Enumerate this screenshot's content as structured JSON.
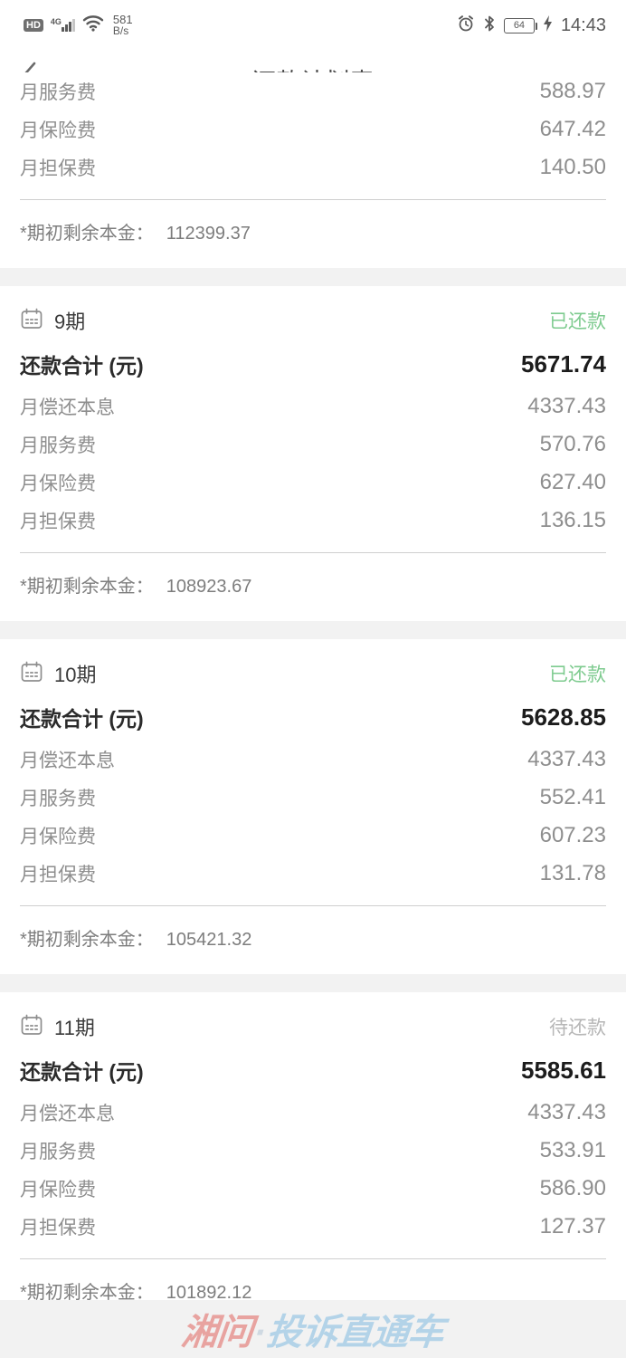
{
  "status_bar": {
    "hd_label": "HD",
    "network_type": "4G",
    "signal_icon": "signal-bars-icon",
    "wifi_icon": "wifi-icon",
    "net_speed_value": "581",
    "net_speed_unit": "B/s",
    "alarm_icon": "alarm-clock-icon",
    "bluetooth_icon": "bluetooth-icon",
    "battery_level": "64",
    "charging_icon": "lightning-bolt-icon",
    "time": "14:43"
  },
  "app_bar": {
    "back_icon": "chevron-left-icon",
    "title": "还款计划表"
  },
  "labels": {
    "principal_interest": "月偿还本息",
    "service_fee": "月服务费",
    "insurance_fee": "月保险费",
    "guarantee_fee": "月担保费",
    "total": "还款合计 (元)",
    "remaining_note": "*期初剩余本金：",
    "calendar_icon": "calendar-icon"
  },
  "status_text": {
    "paid": "已还款",
    "pending": "待还款"
  },
  "colors": {
    "paid": "#7ecb8f",
    "pending": "#b6b6b6",
    "page_bg": "#f2f2f2",
    "card_bg": "#ffffff",
    "watermark_red": "#e8a3a0",
    "watermark_blue": "#b3d3e8"
  },
  "periods": [
    {
      "partial": true,
      "period": "",
      "status": "",
      "total": "",
      "service_fee": "588.97",
      "insurance_fee": "647.42",
      "guarantee_fee": "140.50",
      "remaining_principal": "112399.37"
    },
    {
      "partial": false,
      "period": "9期",
      "status": "已还款",
      "status_kind": "paid",
      "total": "5671.74",
      "principal_interest": "4337.43",
      "service_fee": "570.76",
      "insurance_fee": "627.40",
      "guarantee_fee": "136.15",
      "remaining_principal": "108923.67"
    },
    {
      "partial": false,
      "period": "10期",
      "status": "已还款",
      "status_kind": "paid",
      "total": "5628.85",
      "principal_interest": "4337.43",
      "service_fee": "552.41",
      "insurance_fee": "607.23",
      "guarantee_fee": "131.78",
      "remaining_principal": "105421.32"
    },
    {
      "partial": false,
      "period": "11期",
      "status": "待还款",
      "status_kind": "pending",
      "total": "5585.61",
      "principal_interest": "4337.43",
      "service_fee": "533.91",
      "insurance_fee": "586.90",
      "guarantee_fee": "127.37",
      "remaining_principal": "101892.12"
    }
  ],
  "watermark": {
    "part_red": "湘问",
    "separator": "·",
    "part_blue": "投诉直通车"
  }
}
